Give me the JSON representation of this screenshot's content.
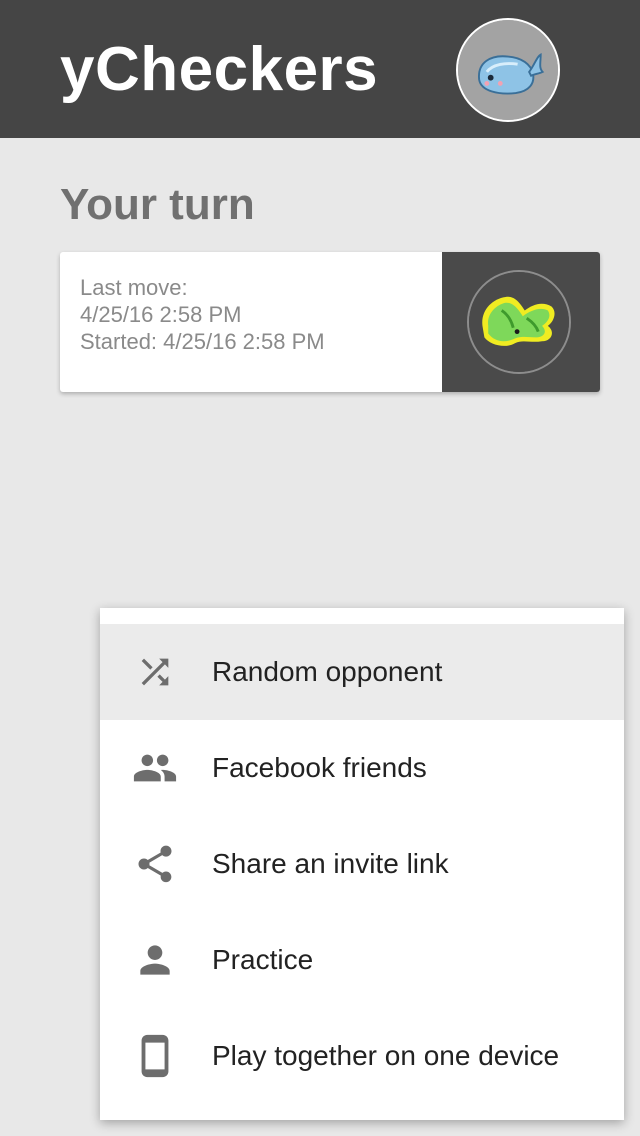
{
  "header": {
    "title": "yCheckers",
    "avatar_icon": "whale-avatar-icon"
  },
  "section": {
    "title": "Your turn"
  },
  "game_card": {
    "last_move_label": "Last move:",
    "last_move_time": "4/25/16 2:58 PM",
    "started_text": "Started: 4/25/16 2:58 PM",
    "opponent_avatar_icon": "green-creature-avatar-icon"
  },
  "menu": {
    "items": [
      {
        "label": "Random opponent",
        "icon": "shuffle-icon"
      },
      {
        "label": "Facebook friends",
        "icon": "people-icon"
      },
      {
        "label": "Share an invite link",
        "icon": "share-icon"
      },
      {
        "label": "Practice",
        "icon": "person-icon"
      },
      {
        "label": "Play together on one device",
        "icon": "phone-icon"
      }
    ]
  },
  "colors": {
    "header_bg": "#454545",
    "page_bg": "#e8e8e8",
    "card_side_bg": "#4a4a4a",
    "menu_highlight": "#ebebeb",
    "icon_color": "#6d6d6d"
  }
}
